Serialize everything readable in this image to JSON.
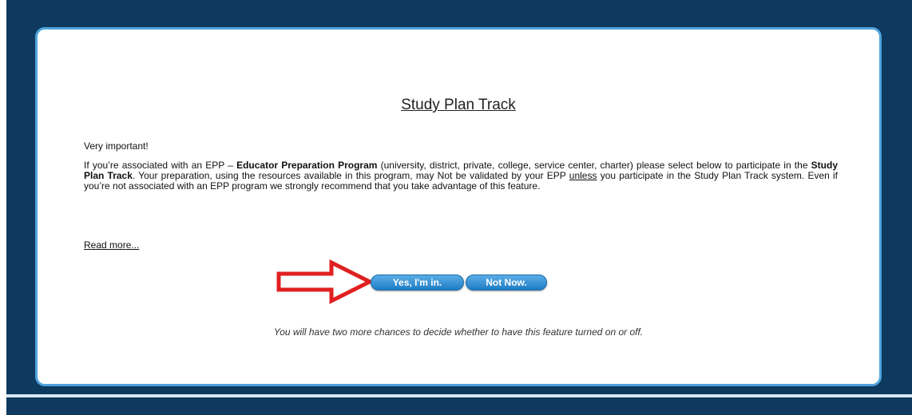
{
  "dialog": {
    "title": "Study Plan Track",
    "intro": "Very important!",
    "paragraph": {
      "part1": "If you’re associated with an EPP – ",
      "bold1": "Educator Preparation Program",
      "part2": " (university, district, private, college, service center, charter) please select below to participate in the ",
      "bold2": "Study Plan Track",
      "part3": ". Your preparation, using the resources available in this program, may Not be validated by your EPP ",
      "underlined": "unless",
      "part4": " you participate in the Study Plan Track system. Even if you’re not associated with an EPP program we strongly recommend that you take advantage of this feature."
    },
    "read_more": "Read more...",
    "yes_button": "Yes, I'm in.",
    "no_button": "Not Now.",
    "note": "You will have two more chances to decide whether to have this feature turned on or off."
  },
  "colors": {
    "backdrop": "#0d3a5e",
    "dialog_border": "#4fa3dd",
    "button": "#1f7cc4",
    "arrow": "#e02020"
  },
  "icons": {
    "pointer": "arrow-right-icon"
  }
}
